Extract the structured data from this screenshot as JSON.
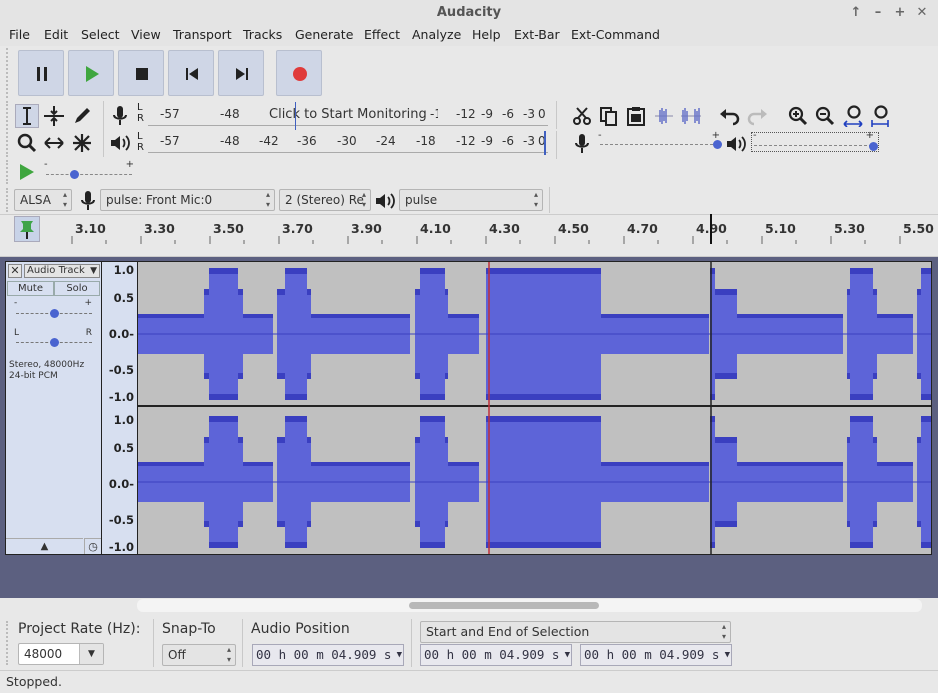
{
  "window": {
    "title": "Audacity"
  },
  "menu": [
    "File",
    "Edit",
    "Select",
    "View",
    "Transport",
    "Tracks",
    "Generate",
    "Effect",
    "Analyze",
    "Help",
    "Ext-Bar",
    "Ext-Command"
  ],
  "meters": {
    "record_scale": [
      "-57",
      "-48",
      "Click to Start Monitoring",
      "-18",
      "-12",
      "-9",
      "-6",
      "-3",
      "0"
    ],
    "record_lr": [
      "L",
      "R"
    ],
    "play_scale": [
      "-57",
      "-48",
      "-42",
      "-36",
      "-30",
      "-24",
      "-18",
      "-12",
      "-9",
      "-6",
      "-3",
      "0"
    ]
  },
  "devices": {
    "host": "ALSA",
    "recording_device": "pulse: Front Mic:0",
    "channels": "2 (Stereo) Re",
    "playback_device": "pulse"
  },
  "timeline": {
    "ticks": [
      "3.10",
      "3.30",
      "3.50",
      "3.70",
      "3.90",
      "4.10",
      "4.30",
      "4.50",
      "4.70",
      "4.90",
      "5.10",
      "5.30",
      "5.50"
    ]
  },
  "track": {
    "name": "Audio Track",
    "mute": "Mute",
    "solo": "Solo",
    "gain_minus": "-",
    "gain_plus": "+",
    "pan_l": "L",
    "pan_r": "R",
    "info": "Stereo, 48000Hz\n24-bit PCM",
    "scale": [
      "1.0",
      "0.5",
      "0.0-",
      "-0.5",
      "-1.0"
    ]
  },
  "selection": {
    "project_rate_label": "Project Rate (Hz):",
    "project_rate": "48000",
    "snap_to_label": "Snap-To",
    "snap_to": "Off",
    "audio_position_label": "Audio Position",
    "audio_position": "00 h 00 m 04.909 s",
    "mode": "Start and End of Selection",
    "start": "00 h 00 m 04.909 s",
    "end": "00 h 00 m 04.909 s"
  },
  "status": "Stopped.",
  "colors": {
    "waveform": "#5d64d8",
    "waveform_dark": "#3a3fc0",
    "bg": "#c0c0c0",
    "cursor": "#c0303a"
  }
}
